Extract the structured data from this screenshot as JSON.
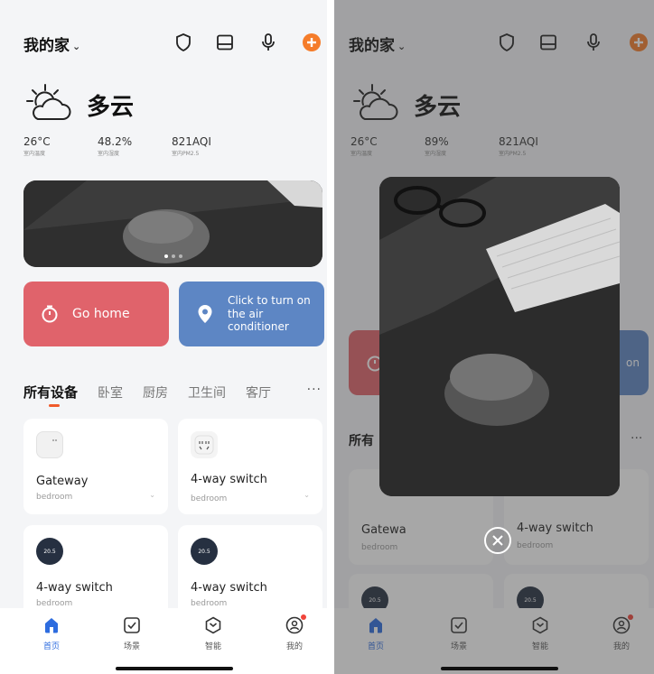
{
  "left_screen": {
    "home_title": "我的家",
    "weather": {
      "condition": "多云",
      "stats": [
        {
          "value": "26°C",
          "label": "室内温度"
        },
        {
          "value": "48.2%",
          "label": "室内湿度"
        },
        {
          "value": "821AQI",
          "label": "室内PM2.5"
        }
      ]
    },
    "actions": [
      {
        "label": "Go home",
        "icon": "timer-icon"
      },
      {
        "label": "Click to turn on the air conditioner",
        "icon": "location-pin-icon"
      }
    ],
    "tabs": [
      "所有设备",
      "卧室",
      "厨房",
      "卫生间",
      "客厅"
    ],
    "tab_more": "···",
    "devices": [
      {
        "name": "Gateway",
        "room": "bedroom"
      },
      {
        "name": "4-way switch",
        "room": "bedroom"
      },
      {
        "name": "4-way switch",
        "room": "bedroom"
      },
      {
        "name": "4-way switch",
        "room": "bedroom"
      }
    ],
    "thermo_reading": "20.5",
    "nav": [
      {
        "label": "首页",
        "icon": "home-icon"
      },
      {
        "label": "场景",
        "icon": "checkbox-icon"
      },
      {
        "label": "智能",
        "icon": "hexagon-icon"
      },
      {
        "label": "我的",
        "icon": "profile-icon"
      }
    ]
  },
  "right_screen": {
    "home_title": "我的家",
    "weather": {
      "condition": "多云",
      "stats": [
        {
          "value": "26°C",
          "label": "室内温度"
        },
        {
          "value": "89%",
          "label": "室内湿度"
        },
        {
          "value": "821AQI",
          "label": "室内PM2.5"
        }
      ]
    },
    "action_fragment": "on",
    "tab_fragment": "所有",
    "tab_more": "···",
    "devices": [
      {
        "name": "Gatewa",
        "room": "bedroom"
      },
      {
        "name": "4-way switch",
        "room": "bedroom"
      }
    ],
    "thermo_reading": "20.5",
    "nav": [
      {
        "label": "首页",
        "icon": "home-icon"
      },
      {
        "label": "场景",
        "icon": "checkbox-icon"
      },
      {
        "label": "智能",
        "icon": "hexagon-icon"
      },
      {
        "label": "我的",
        "icon": "profile-icon"
      }
    ]
  },
  "colors": {
    "accent_orange": "#f57c2a",
    "action_red": "#e0636b",
    "action_blue": "#5d86c4",
    "nav_active": "#2d6cdf"
  }
}
